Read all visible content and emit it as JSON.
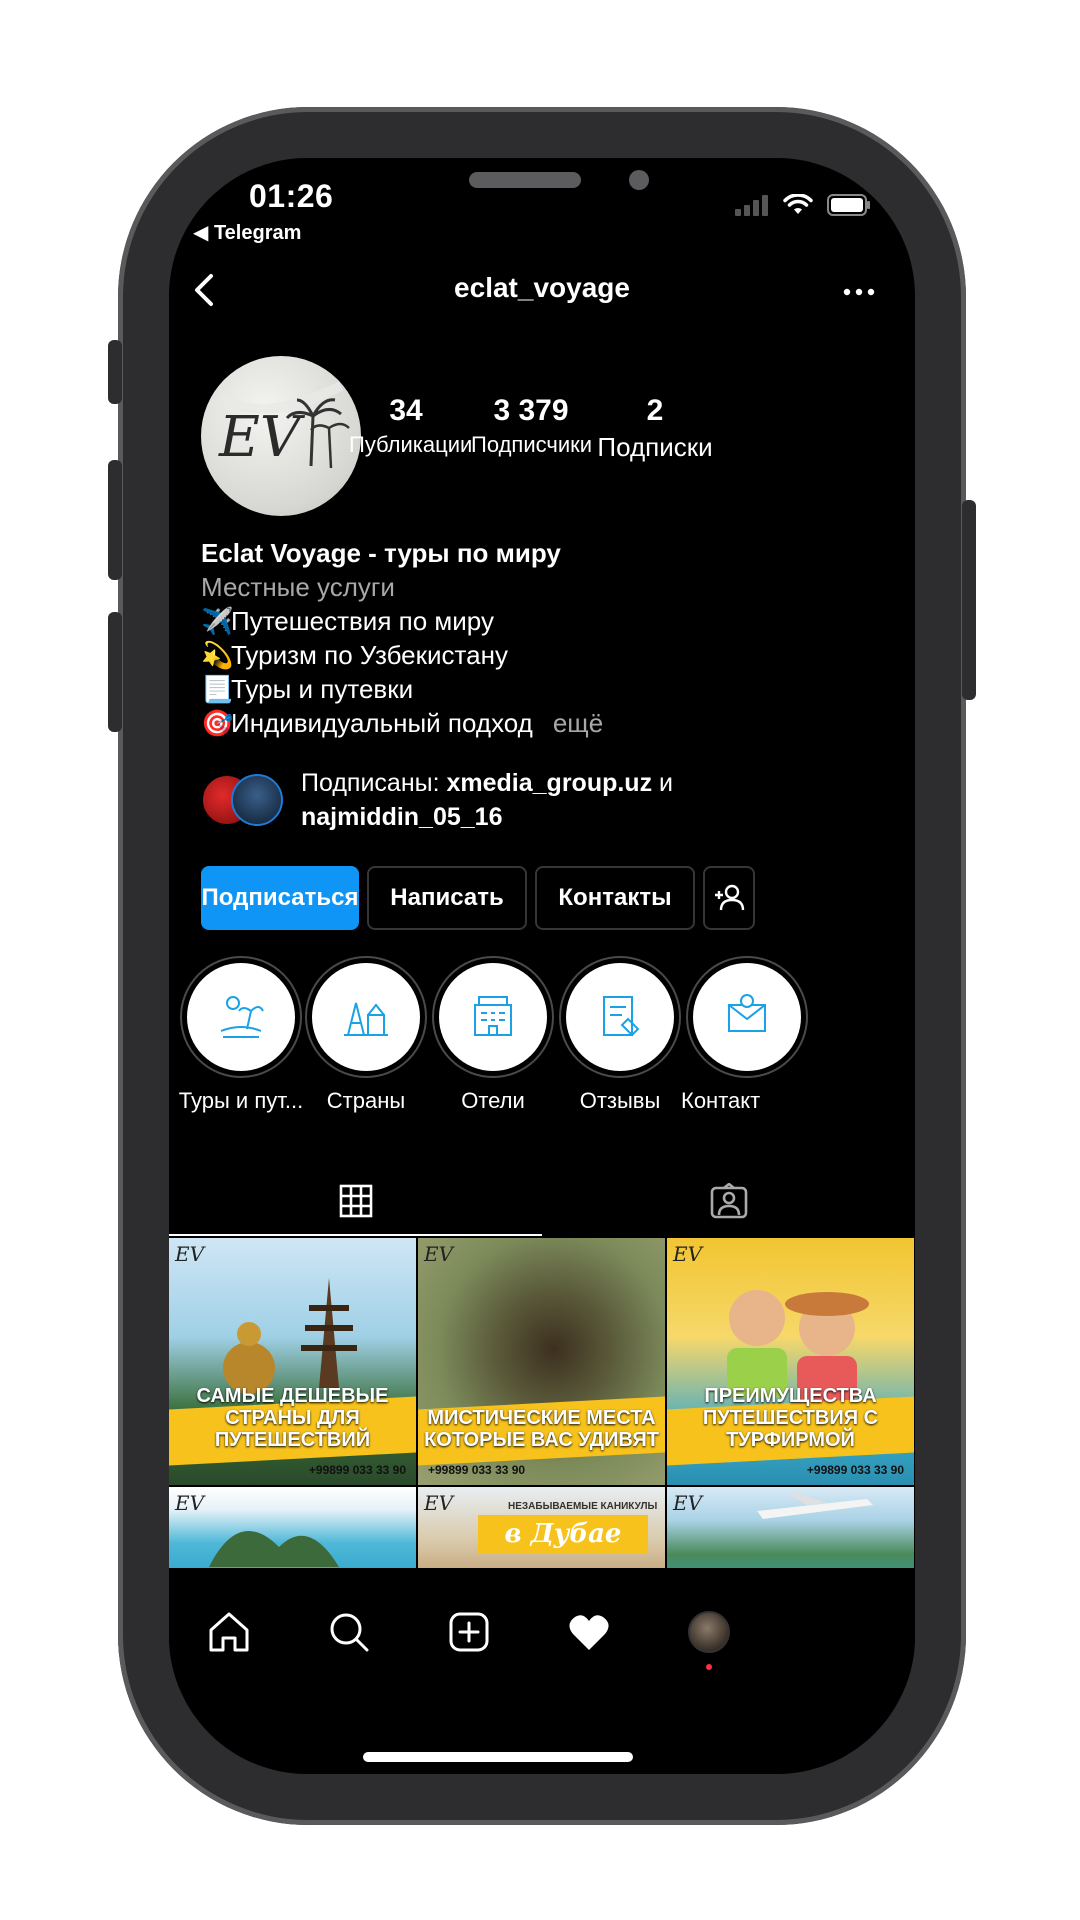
{
  "status_bar": {
    "time": "01:26",
    "back_app": "◀ Telegram"
  },
  "header": {
    "username": "eclat_voyage"
  },
  "stats": [
    {
      "value": "34",
      "label": "Публикации"
    },
    {
      "value": "3 379",
      "label": "Подписчики"
    },
    {
      "value": "2",
      "label": "Подписки"
    }
  ],
  "bio": {
    "name": "Eclat Voyage - туры по миру",
    "category": "Местные услуги",
    "lines": [
      {
        "emoji": "✈️",
        "text": "Путешествия по миру"
      },
      {
        "emoji": "💫",
        "text": "Туризм по Узбекистану"
      },
      {
        "emoji": "📃",
        "text": "Туры и путевки"
      },
      {
        "emoji": "🎯",
        "text": "Индивидуальный подход"
      }
    ],
    "more": "ещё"
  },
  "followed_by": {
    "prefix": "Подписаны: ",
    "user1": "xmedia_group.uz",
    "and": " и",
    "user2": "najmiddin_05_16"
  },
  "buttons": {
    "follow": "Подписаться",
    "message": "Написать",
    "contacts": "Контакты"
  },
  "highlights": [
    {
      "label": "Туры и пут...",
      "icon": "beach-icon"
    },
    {
      "label": "Страны",
      "icon": "landmarks-icon"
    },
    {
      "label": "Отели",
      "icon": "hotel-icon"
    },
    {
      "label": "Отзывы",
      "icon": "review-icon"
    },
    {
      "label": "Контакт",
      "icon": "contact-icon"
    }
  ],
  "posts": [
    {
      "caption": "САМЫЕ ДЕШЕВЫЕ СТРАНЫ ДЛЯ ПУТЕШЕСТВИЙ",
      "phone": "+99899 033 33 90",
      "colors": [
        "#cfe6f5",
        "#3a6f3a"
      ]
    },
    {
      "caption": "МИСТИЧЕСКИЕ МЕСТА КОТОРЫЕ ВАС УДИВЯТ",
      "phone": "+99899 033 33 90",
      "colors": [
        "#7c8a5a",
        "#3f4a2a"
      ]
    },
    {
      "caption": "ПРЕИМУЩЕСТВА ПУТЕШЕСТВИЯ С ТУРФИРМОЙ",
      "phone": "+99899 033 33 90",
      "colors": [
        "#f2c531",
        "#3aa7c9"
      ]
    },
    {
      "caption": "",
      "phone": "",
      "colors": [
        "#ffffff",
        "#1f9bc2"
      ]
    },
    {
      "caption": "в Дубае",
      "subcaption": "НЕЗАБЫВАЕМЫЕ КАНИКУЛЫ",
      "phone": "",
      "colors": [
        "#e8eef2",
        "#b98c5b"
      ]
    },
    {
      "caption": "",
      "phone": "",
      "colors": [
        "#d8e9f5",
        "#2a9fb8"
      ]
    }
  ],
  "logo_text": "EV",
  "colors": {
    "accent": "#0f95f6",
    "background": "#000000",
    "secondary_text": "#a8a8a8"
  }
}
